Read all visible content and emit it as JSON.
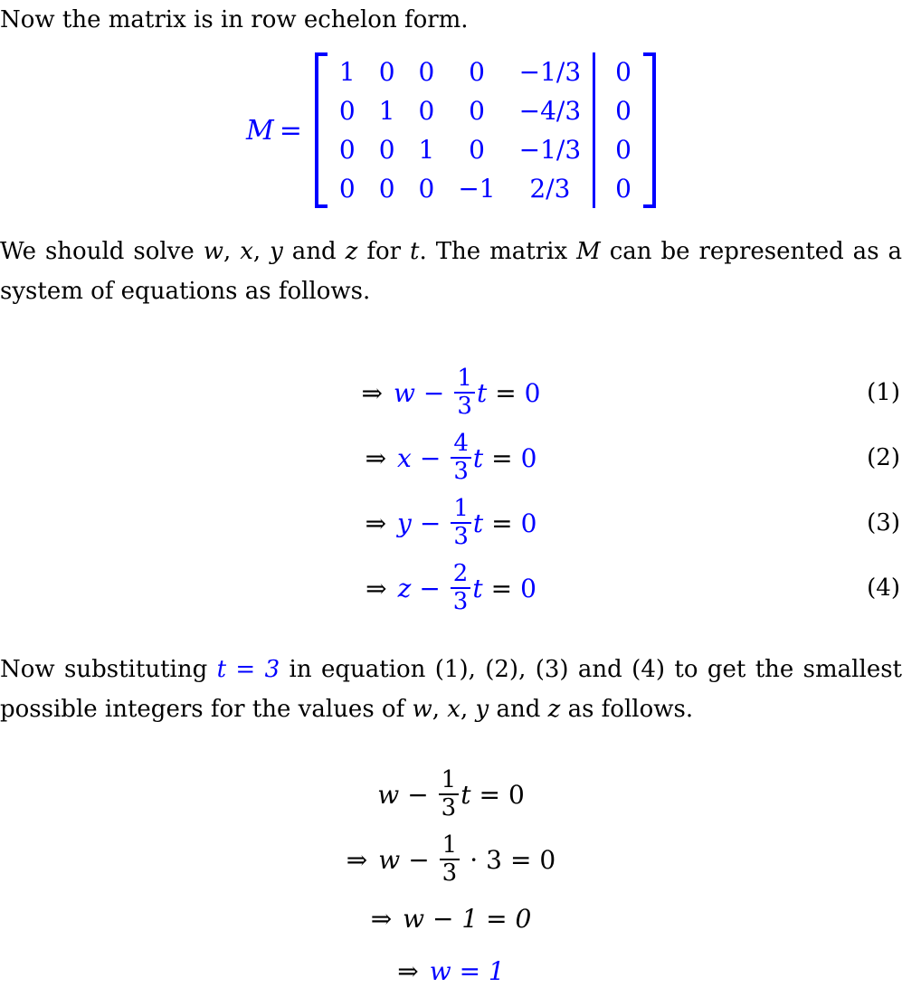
{
  "document": {
    "type": "math-solution-page",
    "text_color": "#000000",
    "highlight_color": "#0000ff"
  },
  "intro": {
    "line": "Now the matrix is in row echelon form."
  },
  "matrix": {
    "label": "M",
    "equals": "=",
    "left_bracket": "[",
    "right_bracket": "]",
    "augmented": true,
    "rows": [
      {
        "coeffs": [
          "1",
          "0",
          "0",
          "0",
          "−1/3"
        ],
        "rhs": "0"
      },
      {
        "coeffs": [
          "0",
          "1",
          "0",
          "0",
          "−4/3"
        ],
        "rhs": "0"
      },
      {
        "coeffs": [
          "0",
          "0",
          "1",
          "0",
          "−1/3"
        ],
        "rhs": "0"
      },
      {
        "coeffs": [
          "0",
          "0",
          "0",
          "−1",
          "2/3"
        ],
        "rhs": "0"
      }
    ]
  },
  "paragraph_1": {
    "seg_1": "We should solve ",
    "var_w": "w",
    "comma_1": ", ",
    "var_x": "x",
    "comma_2": ", ",
    "var_y": "y",
    "seg_2": " and ",
    "var_z": "z",
    "seg_3": " for ",
    "var_t": "t",
    "seg_4": ". The matrix ",
    "var_M": "M",
    "seg_5": " can be represented as a system of equations as follows."
  },
  "equations": [
    {
      "arrow": "⇒",
      "var": "w",
      "minus": "−",
      "num": "1",
      "den": "3",
      "t": "t",
      "equals": "=",
      "rhs": "0",
      "tag": "(1)"
    },
    {
      "arrow": "⇒",
      "var": "x",
      "minus": "−",
      "num": "4",
      "den": "3",
      "t": "t",
      "equals": "=",
      "rhs": "0",
      "tag": "(2)"
    },
    {
      "arrow": "⇒",
      "var": "y",
      "minus": "−",
      "num": "1",
      "den": "3",
      "t": "t",
      "equals": "=",
      "rhs": "0",
      "tag": "(3)"
    },
    {
      "arrow": "⇒",
      "var": "z",
      "minus": "−",
      "num": "2",
      "den": "3",
      "t": "t",
      "equals": "=",
      "rhs": "0",
      "tag": "(4)"
    }
  ],
  "paragraph_2": {
    "seg_1": "Now substituting ",
    "substitution": "t = 3",
    "seg_2": " in equation (1), (2), (3) and (4) to get the smallest possible integers for the values of ",
    "var_w": "w",
    "comma_1": ", ",
    "var_x": "x",
    "comma_2": ", ",
    "var_y": "y",
    "seg_3": " and ",
    "var_z": "z",
    "seg_4": " as follows."
  },
  "final_derivation": {
    "line_1": {
      "var": "w",
      "minus": "−",
      "num": "1",
      "den": "3",
      "t": "t",
      "equals": "=",
      "rhs": "0"
    },
    "line_2": {
      "arrow": "⇒",
      "var": "w",
      "minus": "−",
      "num": "1",
      "den": "3",
      "dot": "·",
      "factor": "3",
      "equals": "=",
      "rhs": "0"
    },
    "line_3": {
      "arrow": "⇒",
      "expr": "w − 1 = 0"
    },
    "line_4": {
      "arrow": "⇒",
      "result": "w = 1"
    }
  }
}
